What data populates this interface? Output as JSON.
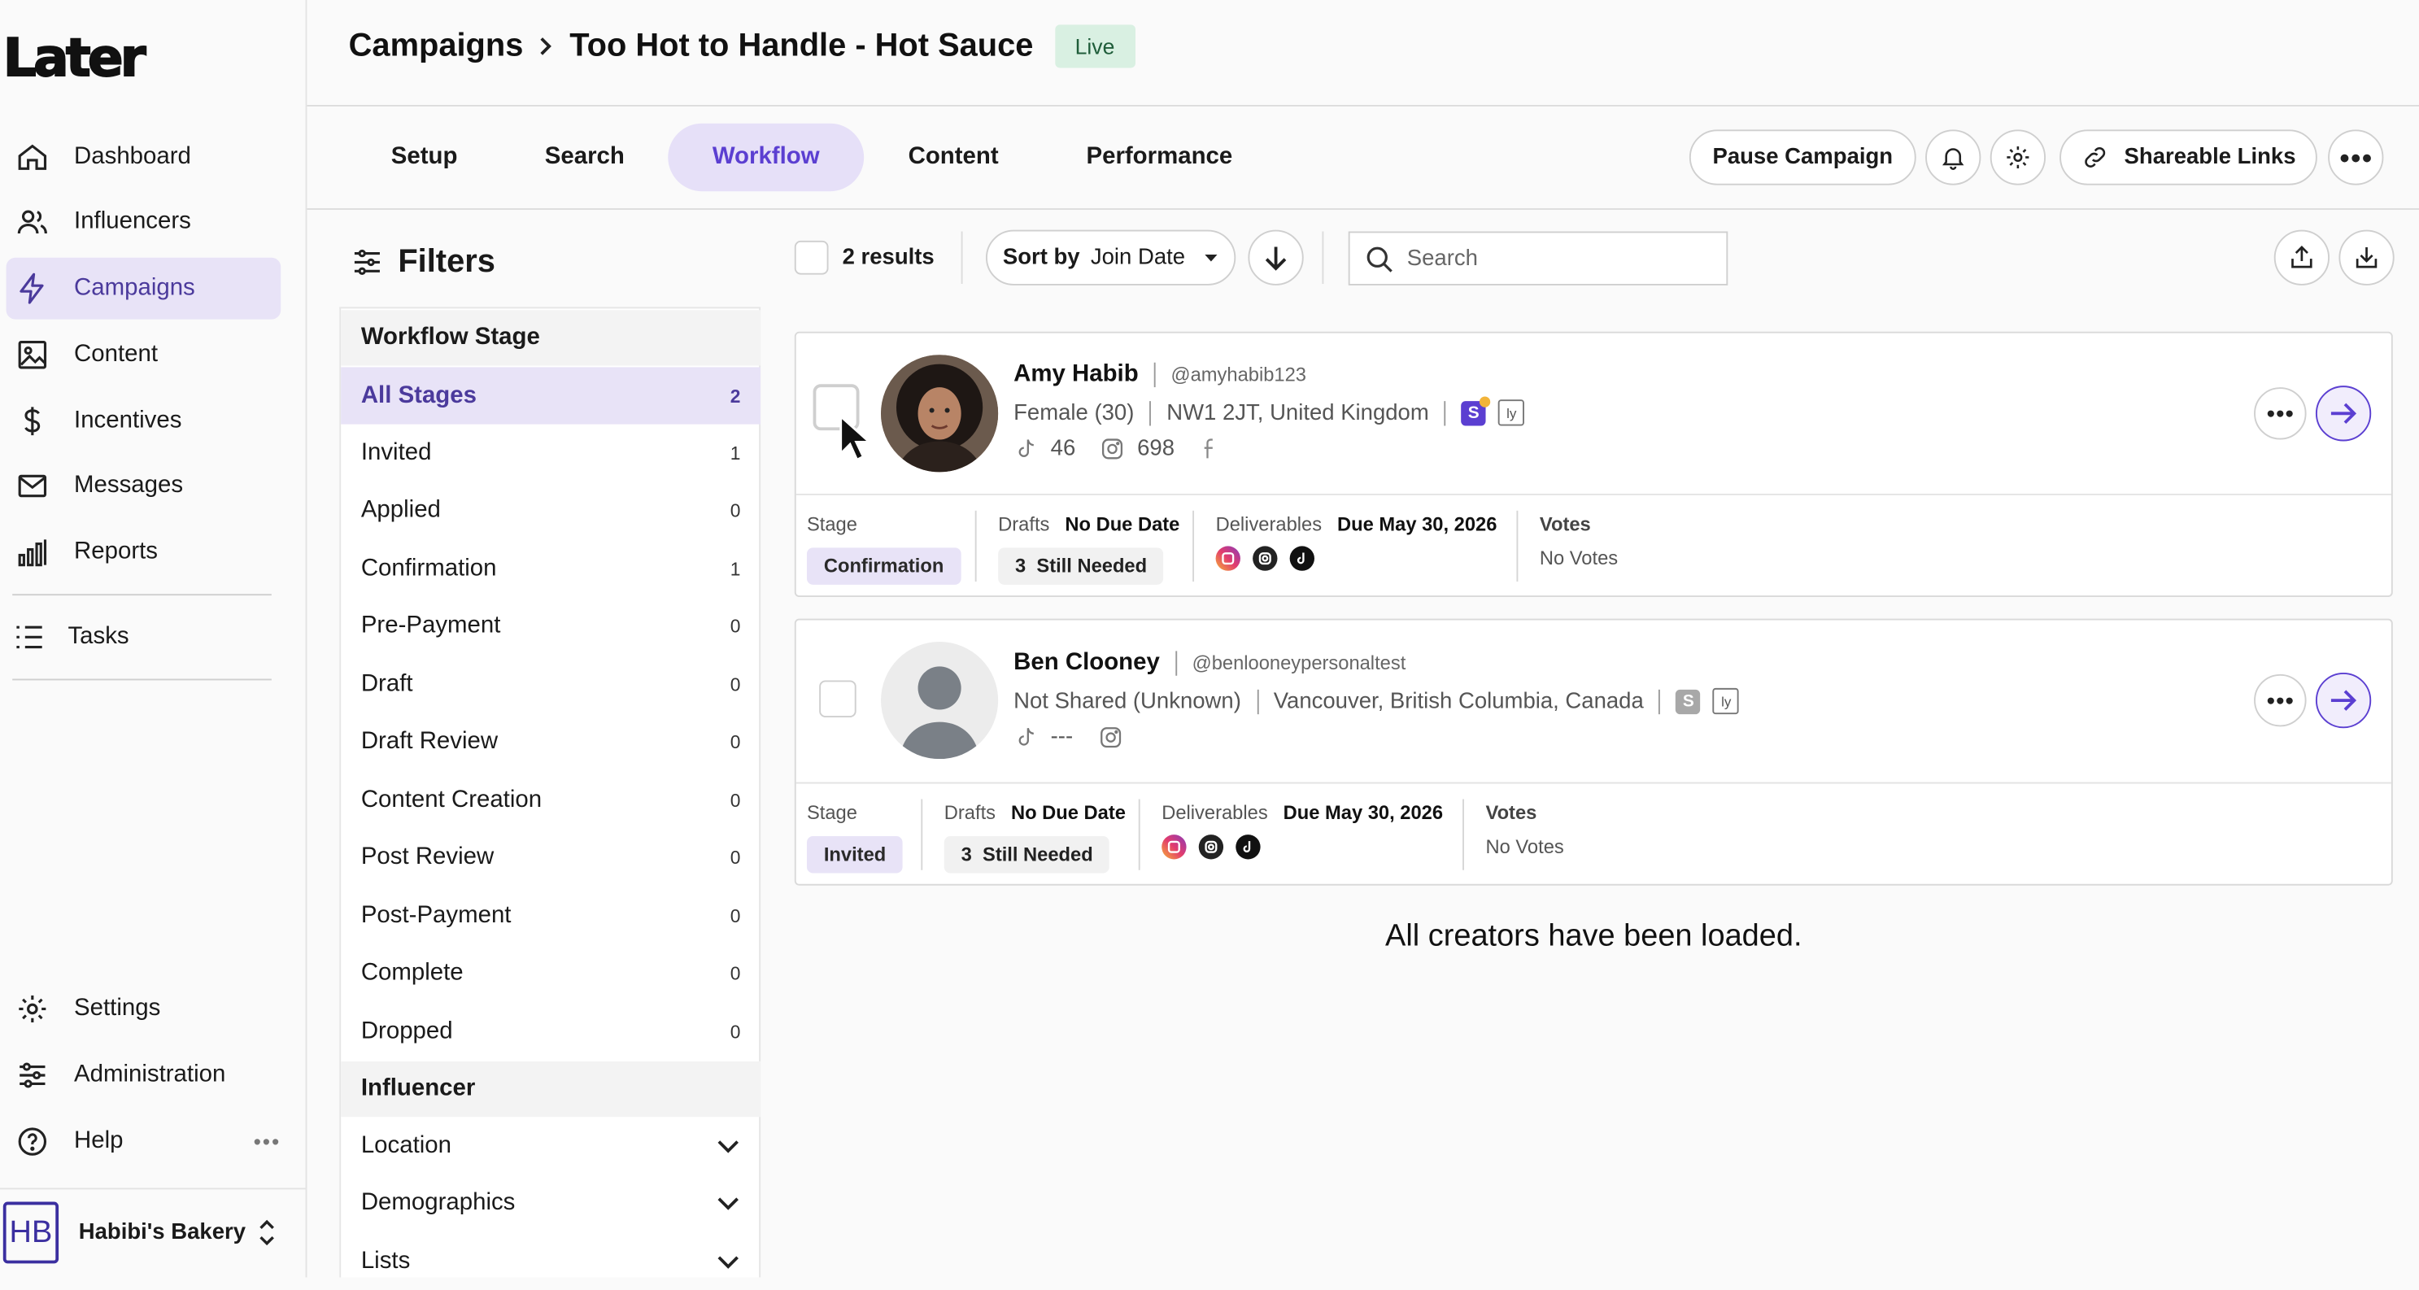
{
  "brand": {
    "logo_text": "Later"
  },
  "sidebar": {
    "items": [
      {
        "label": "Dashboard",
        "icon": "home-icon"
      },
      {
        "label": "Influencers",
        "icon": "users-icon"
      },
      {
        "label": "Campaigns",
        "icon": "bolt-icon",
        "active": true
      },
      {
        "label": "Content",
        "icon": "image-icon"
      },
      {
        "label": "Incentives",
        "icon": "dollar-icon"
      },
      {
        "label": "Messages",
        "icon": "mail-icon"
      },
      {
        "label": "Reports",
        "icon": "bar-chart-icon"
      }
    ],
    "tasks": {
      "label": "Tasks",
      "icon": "list-icon"
    },
    "bottom": [
      {
        "label": "Settings",
        "icon": "gear-icon"
      },
      {
        "label": "Administration",
        "icon": "sliders-icon"
      },
      {
        "label": "Help",
        "icon": "question-icon"
      }
    ],
    "workspace": {
      "initials": "HB",
      "name": "Habibi's Bakery"
    }
  },
  "header": {
    "breadcrumb_root": "Campaigns",
    "breadcrumb_sep": ">",
    "campaign_title": "Too Hot to Handle - Hot Sauce",
    "status": "Live"
  },
  "tabs": {
    "items": [
      "Setup",
      "Search",
      "Workflow",
      "Content",
      "Performance"
    ],
    "active": "Workflow",
    "pause_label": "Pause Campaign",
    "share_label": "Shareable Links"
  },
  "filters": {
    "title": "Filters",
    "workflow_section": "Workflow Stage",
    "stages": [
      {
        "label": "All Stages",
        "count": "2",
        "active": true
      },
      {
        "label": "Invited",
        "count": "1"
      },
      {
        "label": "Applied",
        "count": "0"
      },
      {
        "label": "Confirmation",
        "count": "1"
      },
      {
        "label": "Pre-Payment",
        "count": "0"
      },
      {
        "label": "Draft",
        "count": "0"
      },
      {
        "label": "Draft Review",
        "count": "0"
      },
      {
        "label": "Content Creation",
        "count": "0"
      },
      {
        "label": "Post Review",
        "count": "0"
      },
      {
        "label": "Post-Payment",
        "count": "0"
      },
      {
        "label": "Complete",
        "count": "0"
      },
      {
        "label": "Dropped",
        "count": "0"
      }
    ],
    "influencer_section": "Influencer",
    "collapsibles": [
      "Location",
      "Demographics",
      "Lists"
    ]
  },
  "toolbar": {
    "results": "2 results",
    "sort_prefix": "Sort by",
    "sort_value": "Join Date",
    "search_placeholder": "Search"
  },
  "creators": [
    {
      "name": "Amy Habib",
      "handle": "@amyhabib123",
      "gender": "Female (30)",
      "location": "NW1 2JT, United Kingdom",
      "tiktok": "46",
      "instagram": "698",
      "stage_label": "Stage",
      "stage": "Confirmation",
      "drafts_label": "Drafts",
      "drafts_due": "No Due Date",
      "needed": "3  Still Needed",
      "deliverables_label": "Deliverables",
      "deliverables_due": "Due May 30, 2026",
      "votes_label": "Votes",
      "votes": "No Votes"
    },
    {
      "name": "Ben Clooney",
      "handle": "@benlooneypersonaltest",
      "gender": "Not Shared (Unknown)",
      "location": "Vancouver, British Columbia, Canada",
      "tiktok": "---",
      "stage_label": "Stage",
      "stage": "Invited",
      "drafts_label": "Drafts",
      "drafts_due": "No Due Date",
      "needed": "3  Still Needed",
      "deliverables_label": "Deliverables",
      "deliverables_due": "Due May 30, 2026",
      "votes_label": "Votes",
      "votes": "No Votes"
    }
  ],
  "footer_message": "All creators have been loaded.",
  "colors": {
    "accent": "#5b3fd1",
    "active_bg": "#e8e3f7",
    "live_bg": "#d9f0e2"
  }
}
